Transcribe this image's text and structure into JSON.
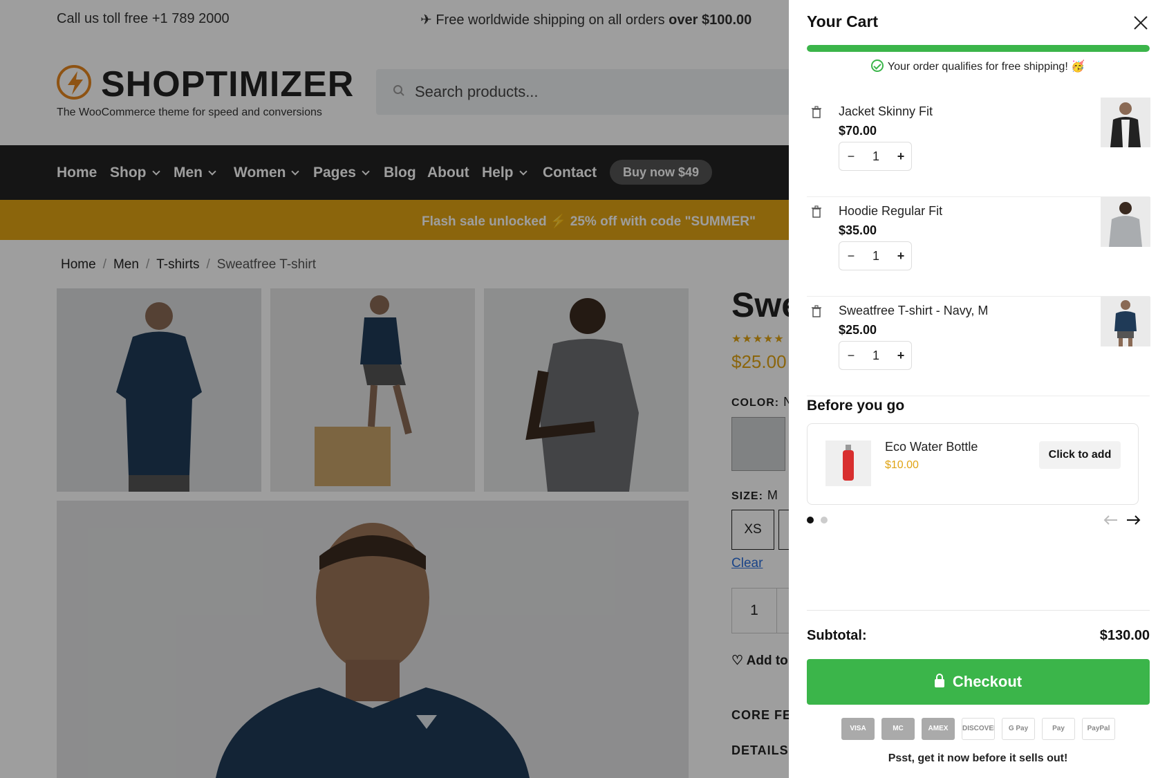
{
  "topbar": {
    "call": "Call us toll free +1 789 2000",
    "shipping_prefix": "✈ Free worldwide shipping on all orders ",
    "shipping_bold": "over $100.00"
  },
  "header": {
    "logo_name": "SHOPTIMIZER",
    "logo_tagline": "The WooCommerce theme for speed and conversions",
    "search_placeholder": "Search products..."
  },
  "nav": {
    "items": [
      "Home",
      "Shop",
      "Men",
      "Women",
      "Pages",
      "Blog",
      "About",
      "Help",
      "Contact"
    ],
    "buy_button": "Buy now $49"
  },
  "flash_banner": "Flash sale unlocked ⚡ 25% off with code \"SUMMER\"",
  "breadcrumb": [
    "Home",
    "Men",
    "T-shirts",
    "Sweatfree T-shirt"
  ],
  "product": {
    "title_partial": "Swe",
    "stars": "★★★★★",
    "price": "$25.00",
    "color_label": "COLOR:",
    "color_value": "N",
    "size_label": "SIZE:",
    "size_value": "M",
    "size_option": "XS",
    "clear_link": "Clear",
    "qty": "1",
    "wishlist": "Add to",
    "core_features": "CORE FEA",
    "details": "DETAILS"
  },
  "cart": {
    "title": "Your Cart",
    "shipping_progress_pct": 100,
    "qualify_text": "Your order qualifies for free shipping! 🥳",
    "items": [
      {
        "name": "Jacket Skinny Fit",
        "price": "$70.00",
        "qty": "1"
      },
      {
        "name": "Hoodie Regular Fit",
        "price": "$35.00",
        "qty": "1"
      },
      {
        "name": "Sweatfree T-shirt - Navy, M",
        "price": "$25.00",
        "qty": "1"
      }
    ],
    "before_you_go": "Before you go",
    "upsell": {
      "name": "Eco Water Bottle",
      "price": "$10.00",
      "button": "Click to add"
    },
    "subtotal_label": "Subtotal:",
    "subtotal_value": "$130.00",
    "checkout_label": "Checkout",
    "payment_methods": [
      "VISA",
      "MC",
      "AMEX",
      "DISCOVER",
      "G Pay",
      "Pay",
      "PayPal"
    ],
    "footer_note": "Psst, get it now before it sells out!"
  },
  "colors": {
    "accent": "#e0a414",
    "green": "#3bb54a",
    "nav_bg": "#222222"
  }
}
